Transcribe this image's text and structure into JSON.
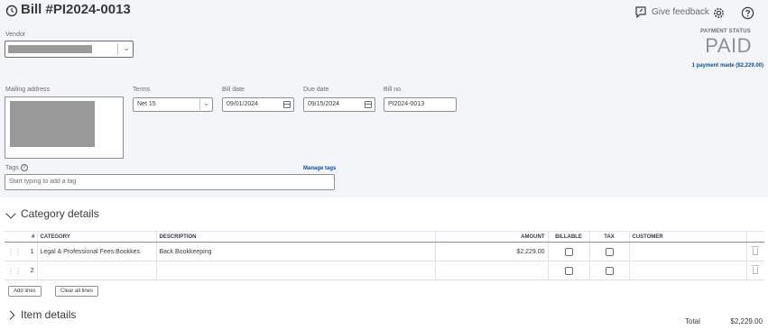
{
  "header": {
    "title": "Bill #PI2024-0013",
    "feedback_label": "Give feedback"
  },
  "payment": {
    "status_label": "PAYMENT STATUS",
    "status": "PAID",
    "payment_made": "1 payment made ($2,229.00)"
  },
  "form": {
    "vendor_label": "Vendor",
    "mailing_label": "Mailing address",
    "terms_label": "Terms",
    "terms_value": "Net 15",
    "bill_date_label": "Bill date",
    "bill_date_value": "09/01/2024",
    "due_date_label": "Due date",
    "due_date_value": "09/15/2024",
    "bill_no_label": "Bill no.",
    "bill_no_value": "PI2024-0013",
    "tags_label": "Tags",
    "tags_placeholder": "Start typing to add a tag",
    "manage_tags": "Manage tags"
  },
  "category": {
    "title": "Category details",
    "columns": [
      "#",
      "CATEGORY",
      "DESCRIPTION",
      "AMOUNT",
      "BILLABLE",
      "TAX",
      "CUSTOMER"
    ],
    "rows": [
      {
        "num": "1",
        "category": "Legal & Professional Fees:Bookkes",
        "description": "Back Bookkeeping",
        "amount": "$2,229.00"
      },
      {
        "num": "2",
        "category": "",
        "description": "",
        "amount": ""
      }
    ],
    "add_lines": "Add lines",
    "clear_lines": "Clear all lines"
  },
  "items": {
    "title": "Item details"
  },
  "total": {
    "label": "Total",
    "value": "$2,229.00"
  },
  "colors": {
    "accent_green": "#2ca01c",
    "link_blue": "#0d4f9e",
    "top_bg": "#f4f5f8"
  }
}
